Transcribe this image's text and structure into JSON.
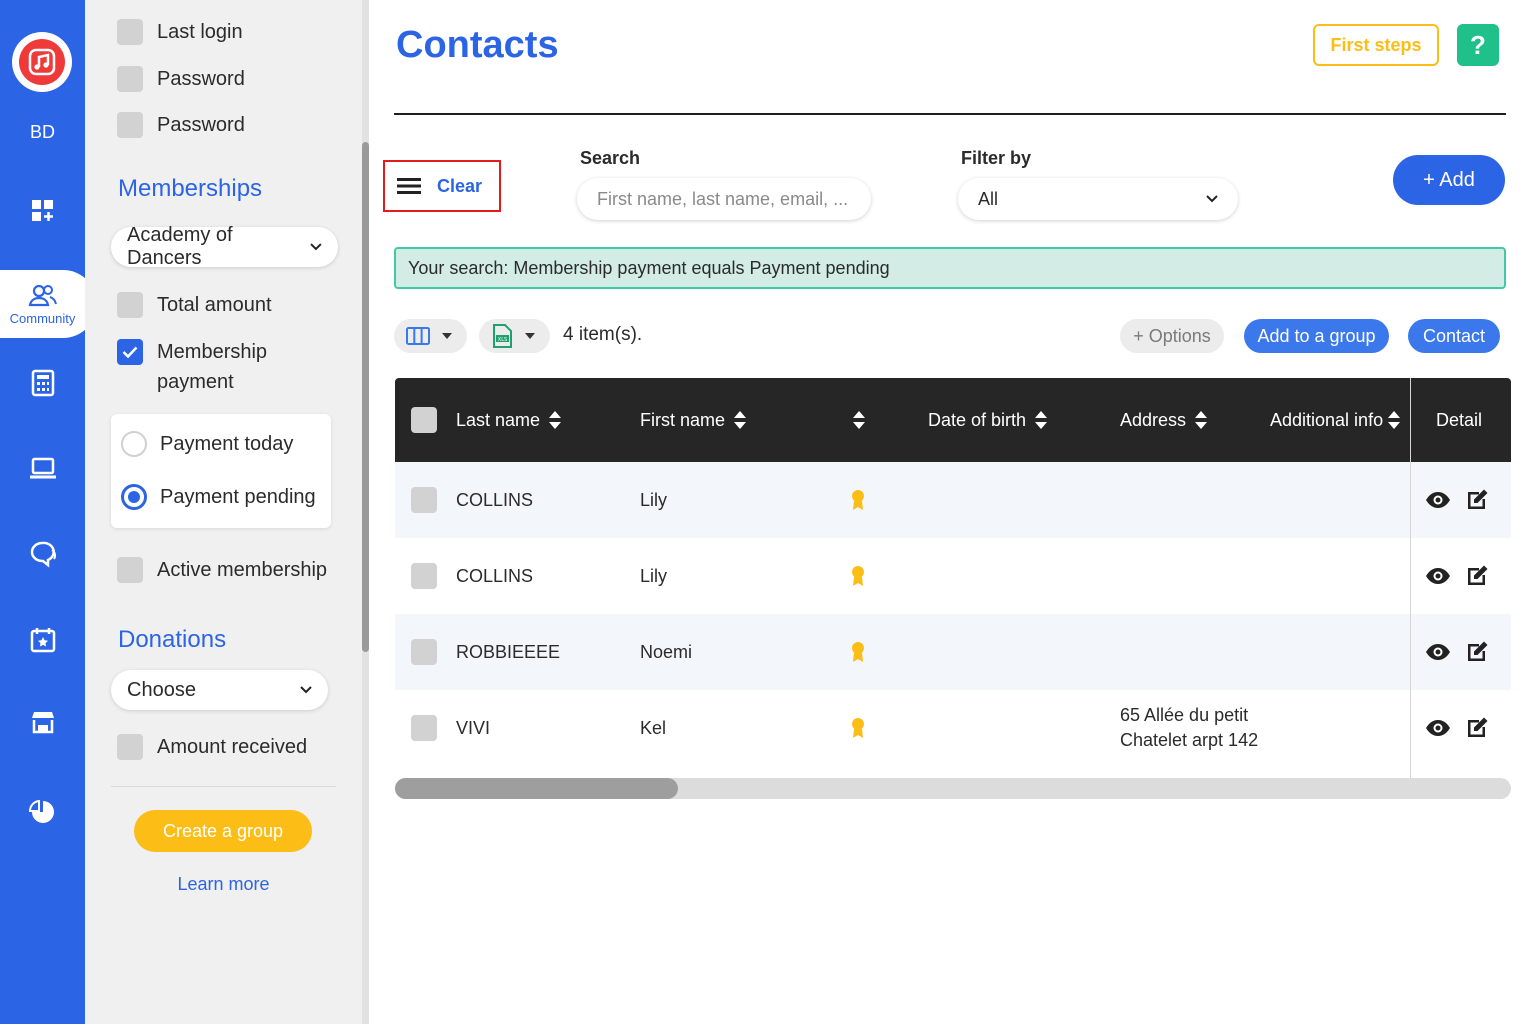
{
  "rail": {
    "initials": "BD",
    "active_label": "Community",
    "icons": [
      "music-logo-icon",
      "dashboard-icon",
      "community-icon",
      "calculator-icon",
      "laptop-icon",
      "chat-icon",
      "calendar-icon",
      "store-icon",
      "chart-icon"
    ]
  },
  "panel": {
    "top_checks": [
      {
        "label": "Last login",
        "checked": false
      },
      {
        "label": "Password",
        "checked": false
      },
      {
        "label": "Password",
        "checked": false
      }
    ],
    "memberships_title": "Memberships",
    "membership_select": "Academy of Dancers",
    "total_amount": "Total amount",
    "membership_payment": "Membership payment",
    "radio_today": "Payment today",
    "radio_pending": "Payment pending",
    "active_membership": "Active membership",
    "donations_title": "Donations",
    "donations_select": "Choose",
    "amount_received": "Amount received",
    "create_group": "Create a group",
    "learn_more": "Learn more"
  },
  "header": {
    "title": "Contacts",
    "first_steps": "First steps",
    "help": "?"
  },
  "toolbar": {
    "clear": "Clear",
    "search_label": "Search",
    "search_placeholder": "First name, last name, email, ...",
    "filter_label": "Filter by",
    "filter_value": "All",
    "add": "+ Add"
  },
  "banner": "Your search: Membership payment equals Payment pending",
  "list_tools": {
    "items_count": "4 item(s).",
    "options": "+ Options",
    "add_to_group": "Add to a group",
    "contact": "Contact"
  },
  "table": {
    "headers": {
      "last_name": "Last name",
      "first_name": "First name",
      "date_of_birth": "Date of birth",
      "address": "Address",
      "additional_info": "Additional info",
      "detail": "Detail"
    },
    "rows": [
      {
        "last_name": "COLLINS",
        "first_name": "Lily",
        "address_1": "",
        "address_2": ""
      },
      {
        "last_name": "COLLINS",
        "first_name": "Lily",
        "address_1": "",
        "address_2": ""
      },
      {
        "last_name": "ROBBIEEEE",
        "first_name": "Noemi",
        "address_1": "",
        "address_2": ""
      },
      {
        "last_name": "VIVI",
        "first_name": "Kel",
        "address_1": "65 Allée du petit",
        "address_2": "Chatelet arpt 142"
      }
    ]
  },
  "colors": {
    "brand_blue": "#2c64e6",
    "accent_yellow": "#fbbd16",
    "help_green": "#1fc089",
    "banner_bg": "#d3ede6",
    "clear_outline": "#e31b1b"
  }
}
